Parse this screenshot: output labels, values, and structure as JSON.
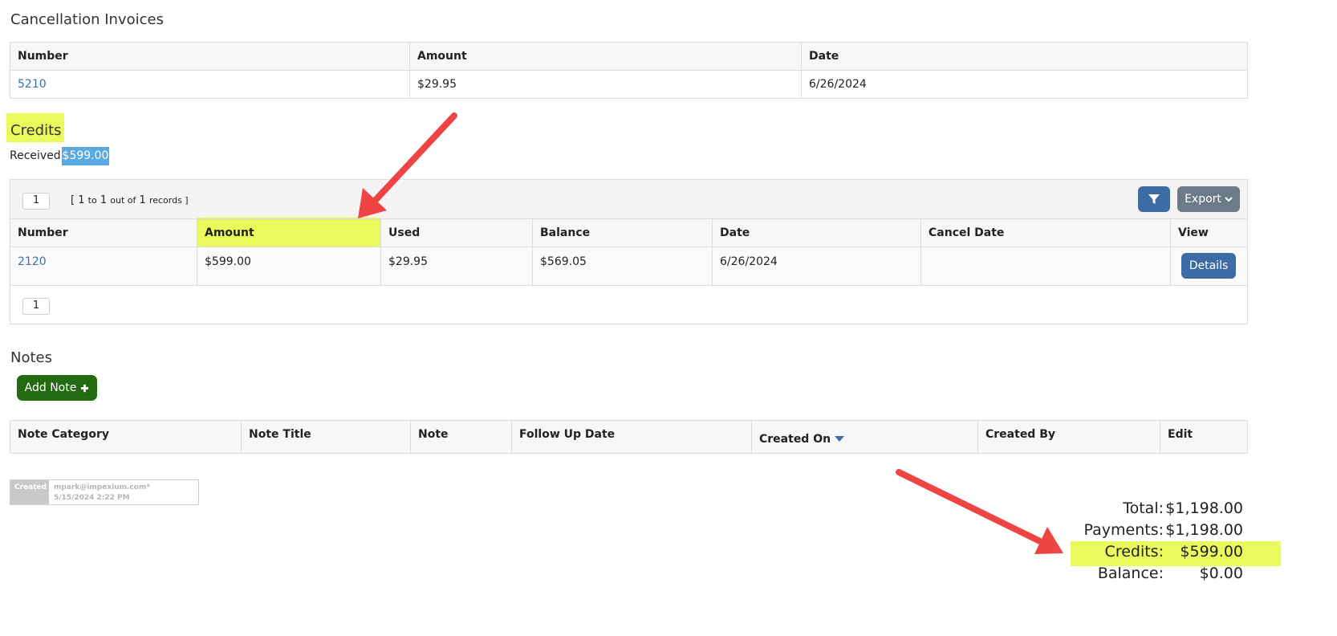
{
  "cancellation": {
    "title": "Cancellation Invoices",
    "headers": [
      "Number",
      "Amount",
      "Date"
    ],
    "row": {
      "number": "5210",
      "amount": "$29.95",
      "date": "6/26/2024"
    }
  },
  "credits": {
    "title": "Credits",
    "received_label": "Received :",
    "received_value": "$599.00",
    "pager": {
      "page": "1",
      "summary_open": "[",
      "from": "1",
      "to_word": "to",
      "to": "1",
      "out_of": "out of",
      "total": "1",
      "records": "records ]"
    },
    "export_label": "Export",
    "headers": [
      "Number",
      "Amount",
      "Used",
      "Balance",
      "Date",
      "Cancel Date",
      "View"
    ],
    "row": {
      "number": "2120",
      "amount": "$599.00",
      "used": "$29.95",
      "balance": "$569.05",
      "date": "6/26/2024",
      "cancel_date": "",
      "view_label": "Details"
    },
    "bottom_page": "1"
  },
  "notes": {
    "title": "Notes",
    "add_label": "Add Note",
    "headers": [
      "Note Category",
      "Note Title",
      "Note",
      "Follow Up Date",
      "Created On",
      "Created By",
      "Edit"
    ]
  },
  "stamp": {
    "tag": "Created",
    "user": "mpark@impexium.com*",
    "when": "5/15/2024 2:22 PM"
  },
  "totals": [
    {
      "label": "Total:",
      "value": "$1,198.00"
    },
    {
      "label": "Payments:",
      "value": "$1,198.00"
    },
    {
      "label": "Credits:",
      "value": "$599.00"
    },
    {
      "label": "Balance:",
      "value": "$0.00"
    }
  ],
  "colors": {
    "highlight": "#eaf95c",
    "arrow": "#ee4444",
    "link": "#3a6fa3",
    "primary": "#3d6ba4",
    "success": "#236b12",
    "secondary": "#6c7a89",
    "badge": "#5aa8e0"
  }
}
